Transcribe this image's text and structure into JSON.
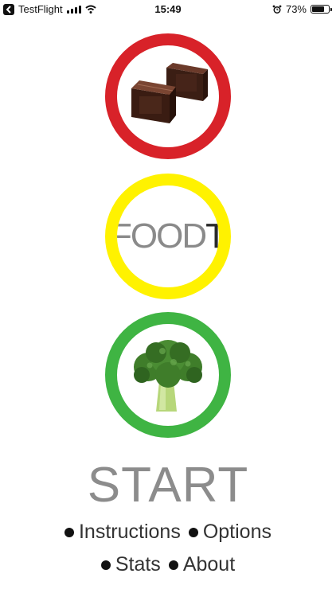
{
  "status_bar": {
    "back_app": "TestFlight",
    "time": "15:49",
    "battery": "73%",
    "battery_level": 0.73,
    "icons": [
      "back-icon",
      "signal-icon",
      "wifi-icon",
      "alarm-icon",
      "battery-icon"
    ]
  },
  "logo": {
    "text_main": "FOOD",
    "text_accent": "T"
  },
  "lights": {
    "red_color": "#d82229",
    "yellow_color": "#fff200",
    "green_color": "#3fb443",
    "red_image": "chocolate-image",
    "green_image": "broccoli-image"
  },
  "start_label": "START",
  "menu": {
    "instructions": "Instructions",
    "options": "Options",
    "stats": "Stats",
    "about": "About"
  }
}
